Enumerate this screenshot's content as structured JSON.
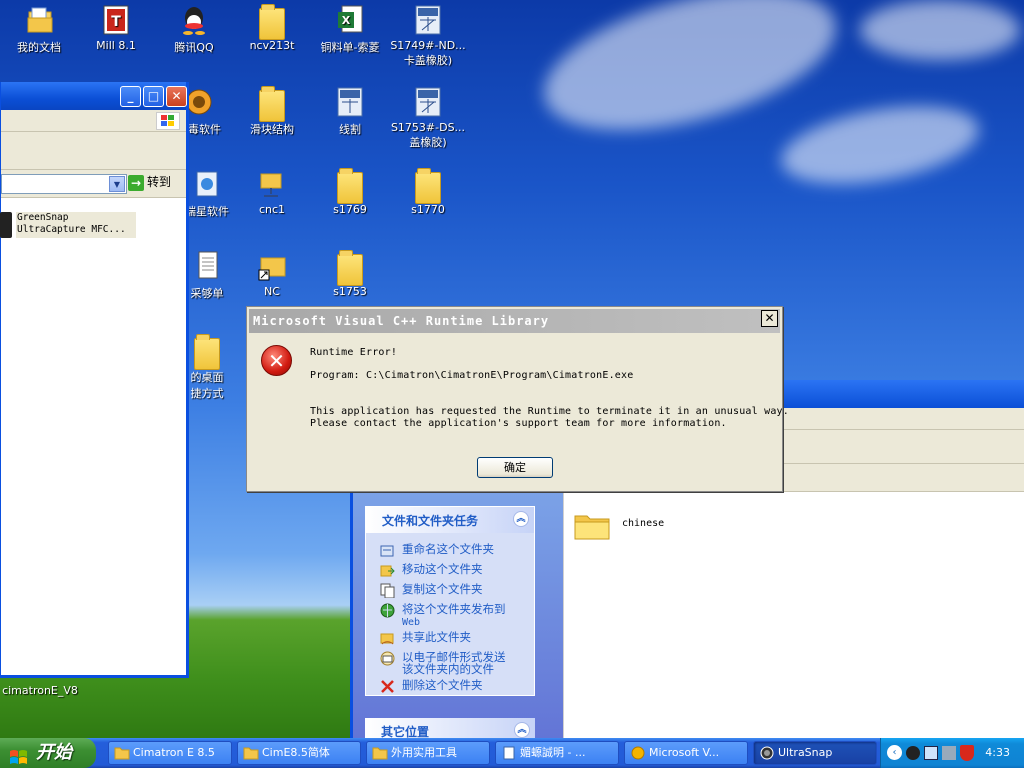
{
  "desktop": {
    "icons": [
      {
        "label": "我的文档",
        "icon": "my-documents-icon"
      },
      {
        "label": "Mill 8.1",
        "icon": "mill-app-icon"
      },
      {
        "label": "腾讯QQ",
        "icon": "qq-icon"
      },
      {
        "label": "ncv213t",
        "icon": "folder-icon"
      },
      {
        "label": "铜料单-索菱",
        "icon": "excel-file-icon"
      },
      {
        "label": "S1749#-ND...",
        "label2": "卡盖橡胶)",
        "icon": "dwg-file-icon"
      },
      {
        "label": "杀毒软件",
        "icon": "antivirus-icon"
      },
      {
        "label": "滑块结构",
        "icon": "folder-icon"
      },
      {
        "label": "线割",
        "icon": "dwg-file-icon"
      },
      {
        "label": "S1753#-DS...",
        "label2": "盖橡胶)",
        "icon": "dwg-file-icon"
      },
      {
        "label": "端星软件",
        "icon": "app-icon"
      },
      {
        "label": "cnc1",
        "icon": "network-folder-icon"
      },
      {
        "label": "s1769",
        "icon": "folder-icon"
      },
      {
        "label": "s1770",
        "icon": "folder-icon"
      },
      {
        "label": "采够单",
        "icon": "document-icon"
      },
      {
        "label": "NC",
        "icon": "folder-shortcut-icon"
      },
      {
        "label": "s1753",
        "icon": "folder-icon"
      },
      {
        "label": "的桌面",
        "label2": "捷方式",
        "icon": "folder-icon"
      },
      {
        "label": "cimatronE_V8",
        "icon": "app-icon"
      }
    ]
  },
  "left_window": {
    "go_label": "转到",
    "items": [
      {
        "line1": "GreenSnap",
        "line2": "UltraCapture MFC..."
      }
    ]
  },
  "explorer": {
    "task_header": "文件和文件夹任务",
    "tasks": [
      {
        "label": "重命名这个文件夹"
      },
      {
        "label": "移动这个文件夹"
      },
      {
        "label": "复制这个文件夹"
      },
      {
        "label": "将这个文件夹发布到",
        "label2": "Web"
      },
      {
        "label": "共享此文件夹"
      },
      {
        "label": "以电子邮件形式发送",
        "label2": "该文件夹内的文件"
      },
      {
        "label": "删除这个文件夹"
      }
    ],
    "other_header": "其它位置",
    "folder_name": "chinese"
  },
  "dialog": {
    "title": "Microsoft Visual C++ Runtime Library",
    "line1": "Runtime Error!",
    "line2": "Program: C:\\Cimatron\\CimatronE\\Program\\CimatronE.exe",
    "line3": "This application has requested the Runtime to terminate it in an unusual way.",
    "line4": "Please contact the application's support team for more information.",
    "ok_label": "确定"
  },
  "taskbar": {
    "start_label": "开始",
    "buttons": [
      {
        "label": "Cimatron E 8.5"
      },
      {
        "label": "CimE8.5简体"
      },
      {
        "label": "外用实用工具"
      },
      {
        "label": "媚螈誠明 - ..."
      },
      {
        "label": "Microsoft V..."
      },
      {
        "label": "UltraSnap"
      }
    ],
    "clock": "4:33"
  }
}
